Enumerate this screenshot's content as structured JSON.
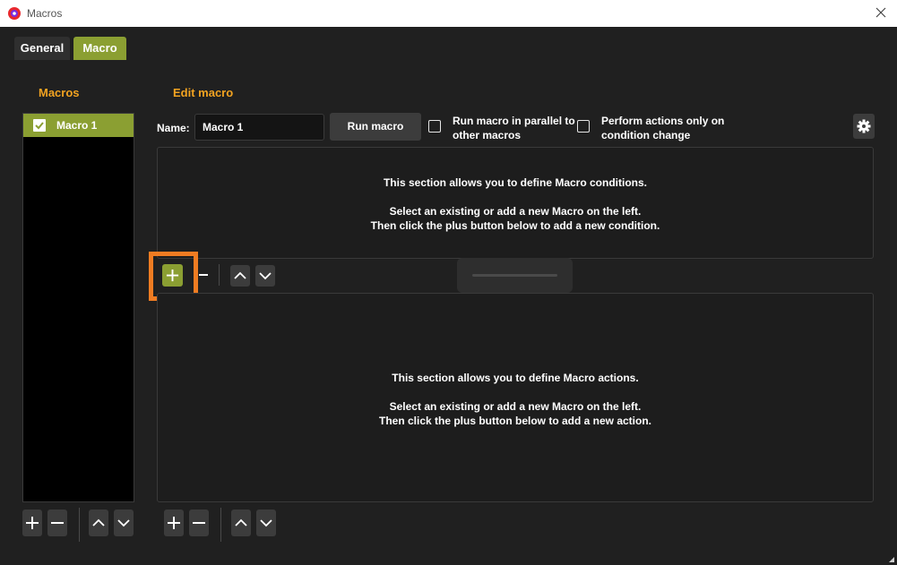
{
  "window": {
    "title": "Macros"
  },
  "tabs": [
    {
      "label": "General"
    },
    {
      "label": "Macro"
    }
  ],
  "left": {
    "section_title": "Macros",
    "items": [
      {
        "label": "Macro 1",
        "checked": true
      }
    ]
  },
  "edit": {
    "section_title": "Edit macro",
    "name_label": "Name:",
    "name_value": "Macro 1",
    "run_button": "Run macro",
    "parallel_label_line1": "Run macro in parallel to",
    "parallel_label_line2": "other macros",
    "parallel_checked": false,
    "perform_label_line1": "Perform actions only on",
    "perform_label_line2": "condition change",
    "perform_checked": false
  },
  "conditions_panel": {
    "line1": "This section allows you to define Macro conditions.",
    "line2": "Select an existing or add a new Macro on the left.",
    "line3": "Then click the plus button below to add a new condition."
  },
  "actions_panel": {
    "line1": "This section allows you to define Macro actions.",
    "line2": "Select an existing or add a new Macro on the left.",
    "line3": "Then click the plus button below to add a new action."
  },
  "colors": {
    "accent_green": "#8b9f32",
    "section_title_orange": "#f2a321",
    "highlight_orange": "#f07c22",
    "background": "#202020"
  },
  "icons": [
    "app-icon",
    "close-icon",
    "checkbox-checked-icon",
    "gear-icon",
    "plus-icon",
    "minus-icon",
    "chevron-up-icon",
    "chevron-down-icon",
    "resize-grip-icon"
  ]
}
